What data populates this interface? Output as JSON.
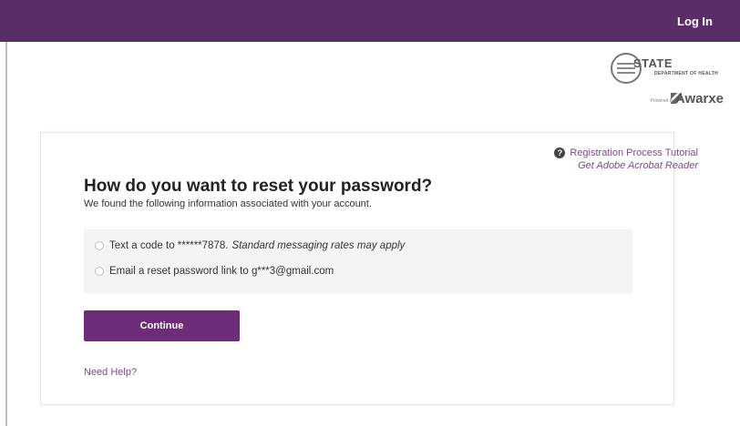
{
  "header": {
    "login_label": "Log In",
    "bar_color": "#5b2d67"
  },
  "branding": {
    "state_name": "STATE",
    "department": "DEPARTMENT OF HEALTH",
    "powered_by": "Powered by",
    "product": "Awarxe",
    "seal_icon": "state-seal-icon",
    "product_icon": "awarxe-logo-icon"
  },
  "links": {
    "tutorial": "Registration Process Tutorial",
    "tutorial_icon": "question-circle-icon",
    "acrobat": "Get Adobe Acrobat Reader",
    "need_help": "Need Help?",
    "link_color": "#7a4a86"
  },
  "form": {
    "title": "How do you want to reset your password?",
    "subtitle": "We found the following information associated with your account.",
    "options": [
      {
        "label": "Text a code to ******7878.",
        "note": "Standard messaging rates may apply",
        "selected": false
      },
      {
        "label": "Email a reset password link to g***3@gmail.com",
        "note": "",
        "selected": false
      }
    ],
    "continue_label": "Continue",
    "button_color": "#6d2c78"
  }
}
